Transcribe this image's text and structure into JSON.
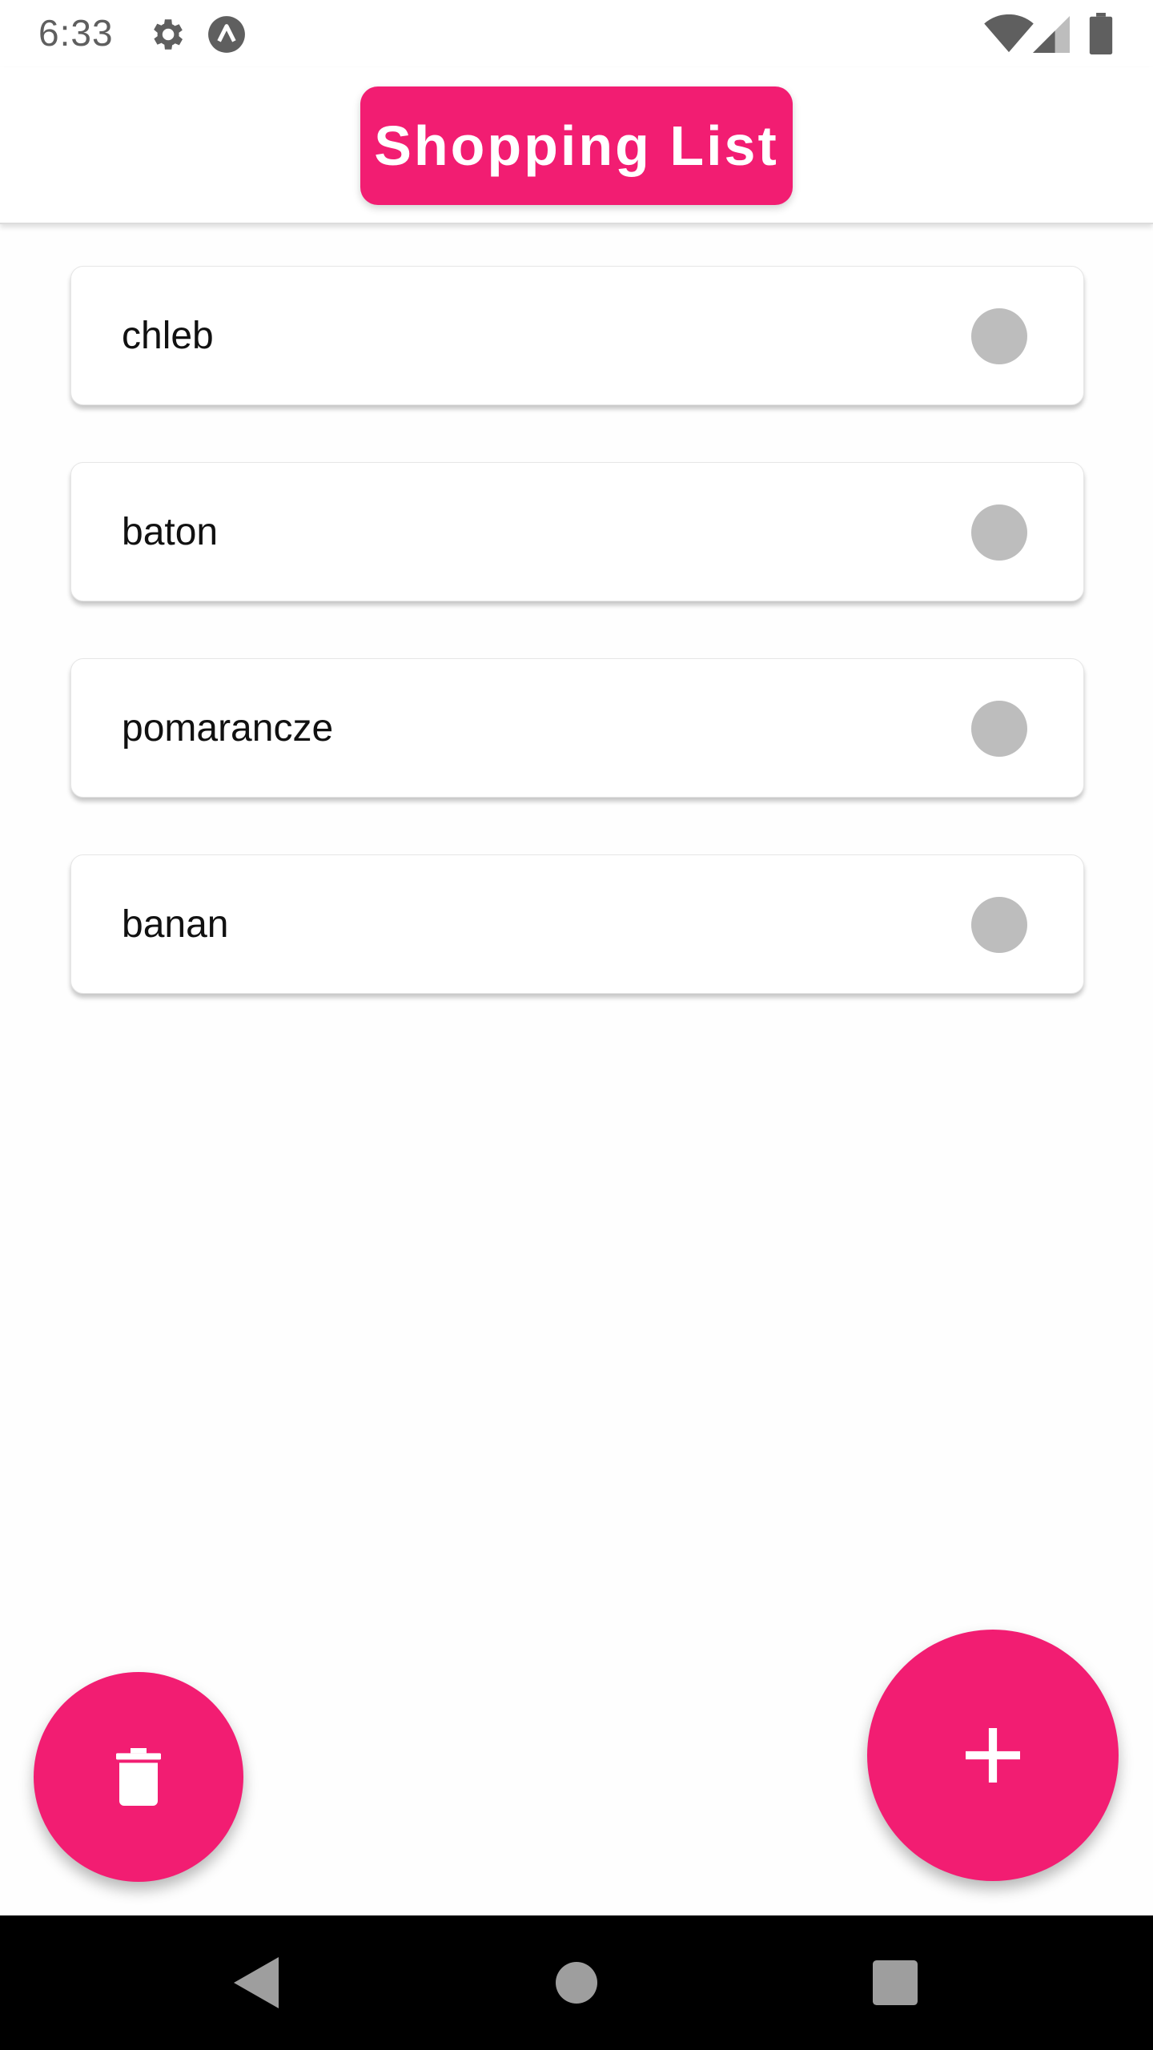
{
  "status_bar": {
    "time": "6:33",
    "icons": [
      "gear-icon",
      "expo-icon",
      "wifi-icon",
      "signal-icon",
      "battery-icon"
    ]
  },
  "header": {
    "title": "Shopping List",
    "accent_color": "#f21d72"
  },
  "list": {
    "items": [
      {
        "label": "chleb",
        "checked": false
      },
      {
        "label": "baton",
        "checked": false
      },
      {
        "label": "pomarancze",
        "checked": false
      },
      {
        "label": "banan",
        "checked": false
      }
    ]
  },
  "fabs": {
    "delete_icon": "trash-icon",
    "add_icon": "plus-icon"
  },
  "nav_bar": {
    "icons": [
      "back-icon",
      "home-icon",
      "recents-icon"
    ]
  }
}
